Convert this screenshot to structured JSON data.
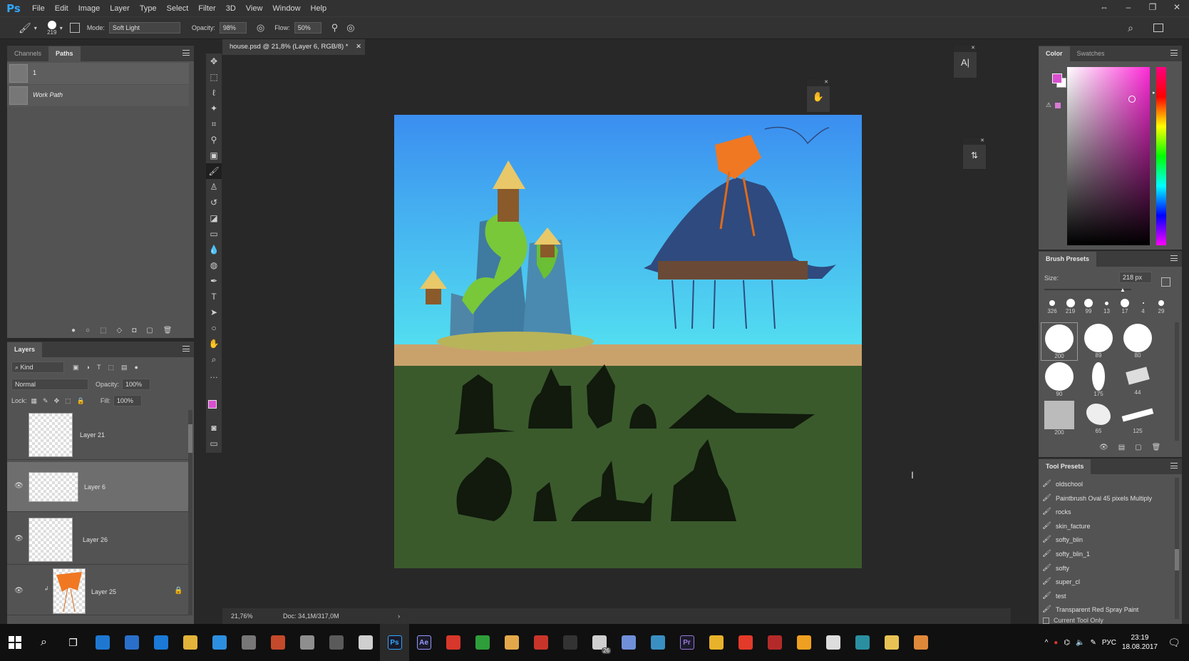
{
  "app": {
    "logo": "Ps"
  },
  "menu": [
    "File",
    "Edit",
    "Image",
    "Layer",
    "Type",
    "Select",
    "Filter",
    "3D",
    "View",
    "Window",
    "Help"
  ],
  "options": {
    "brush_size": "219",
    "mode_label": "Mode:",
    "mode_value": "Soft Light",
    "opacity_label": "Opacity:",
    "opacity_value": "98%",
    "flow_label": "Flow:",
    "flow_value": "50%"
  },
  "paths_panel": {
    "tabs": [
      "Channels",
      "Paths"
    ],
    "items": [
      {
        "label": "1"
      },
      {
        "label": "Work Path"
      }
    ]
  },
  "layers_panel": {
    "tab": "Layers",
    "filter_kind": "Kind",
    "blend_mode": "Normal",
    "opacity_label": "Opacity:",
    "opacity_value": "100%",
    "lock_label": "Lock:",
    "fill_label": "Fill:",
    "fill_value": "100%",
    "layers": [
      {
        "name": "Layer 21",
        "visible": false,
        "selected": false
      },
      {
        "name": "Layer 6",
        "visible": true,
        "selected": true
      },
      {
        "name": "Layer 26",
        "visible": true,
        "selected": false
      },
      {
        "name": "Layer 25",
        "visible": true,
        "selected": false,
        "locked": true
      }
    ]
  },
  "document": {
    "tab_title": "house.psd @ 21,8% (Layer 6, RGB/8) *",
    "zoom": "21,76%",
    "doc_info": "Doc: 34,1M/317,0M"
  },
  "color_panel": {
    "tabs": [
      "Color",
      "Swatches"
    ],
    "foreground": "#d94fd0",
    "background": "#ffffff"
  },
  "brush_presets": {
    "title": "Brush Presets",
    "size_label": "Size:",
    "size_value": "218 px",
    "recent": [
      "326",
      "219",
      "99",
      "13",
      "17",
      "4",
      "29"
    ],
    "grid": [
      "200",
      "89",
      "80",
      "90",
      "175",
      "44",
      "200",
      "65",
      "125"
    ]
  },
  "tool_presets": {
    "title": "Tool Presets",
    "items": [
      "oldschool",
      "Paintbrush Oval 45 pixels Multiply",
      "rocks",
      "skin_facture",
      "softy_blin",
      "softy_blin_1",
      "softy",
      "super_cl",
      "test",
      "Transparent Red Spray Paint"
    ],
    "current_only_label": "Current Tool Only"
  },
  "float_panels": {
    "text_button": "A|"
  },
  "taskbar": {
    "lang": "РУС",
    "time": "23:19",
    "date": "18.08.2017",
    "apps": [
      {
        "icon": "edge-icon",
        "color": "#1e78d2"
      },
      {
        "icon": "store-icon",
        "color": "#2a6fc9"
      },
      {
        "icon": "teamviewer-icon",
        "color": "#1a7ad6"
      },
      {
        "icon": "chrome-icon",
        "color": "#e3b33a"
      },
      {
        "icon": "app-icon",
        "color": "#2d8fe0"
      },
      {
        "icon": "app2-icon",
        "color": "#777777"
      },
      {
        "icon": "app3-icon",
        "color": "#c44a2b"
      },
      {
        "icon": "app4-icon",
        "color": "#8e8e8e"
      },
      {
        "icon": "app5-icon",
        "color": "#5a5a5a"
      },
      {
        "icon": "app6-icon",
        "color": "#cfcfcf"
      },
      {
        "icon": "photoshop-icon",
        "color": "#31a8ff",
        "label": "Ps"
      },
      {
        "icon": "aftereffects-icon",
        "color": "#9999ff",
        "label": "Ae"
      },
      {
        "icon": "app7-icon",
        "color": "#d8372b"
      },
      {
        "icon": "app8-icon",
        "color": "#2e9e3a"
      },
      {
        "icon": "app9-icon",
        "color": "#e3a84a"
      },
      {
        "icon": "app10-icon",
        "color": "#c9342a"
      },
      {
        "icon": "app11-icon",
        "color": "#333333"
      },
      {
        "icon": "mail-icon",
        "color": "#cfcfcf",
        "badge": "26"
      },
      {
        "icon": "app12-icon",
        "color": "#6f8fd8"
      },
      {
        "icon": "app13-icon",
        "color": "#3a8fc2"
      },
      {
        "icon": "premiere-icon",
        "color": "#9a78d8",
        "label": "Pr"
      },
      {
        "icon": "app14-icon",
        "color": "#e8b22a"
      },
      {
        "icon": "app15-icon",
        "color": "#e33a2a"
      },
      {
        "icon": "app16-icon",
        "color": "#b42a2a"
      },
      {
        "icon": "app17-icon",
        "color": "#f0a020"
      },
      {
        "icon": "app18-icon",
        "color": "#dddddd"
      },
      {
        "icon": "app19-icon",
        "color": "#2a8fa0"
      },
      {
        "icon": "folder-icon",
        "color": "#e8c255"
      },
      {
        "icon": "app20-icon",
        "color": "#e0883a"
      }
    ]
  }
}
